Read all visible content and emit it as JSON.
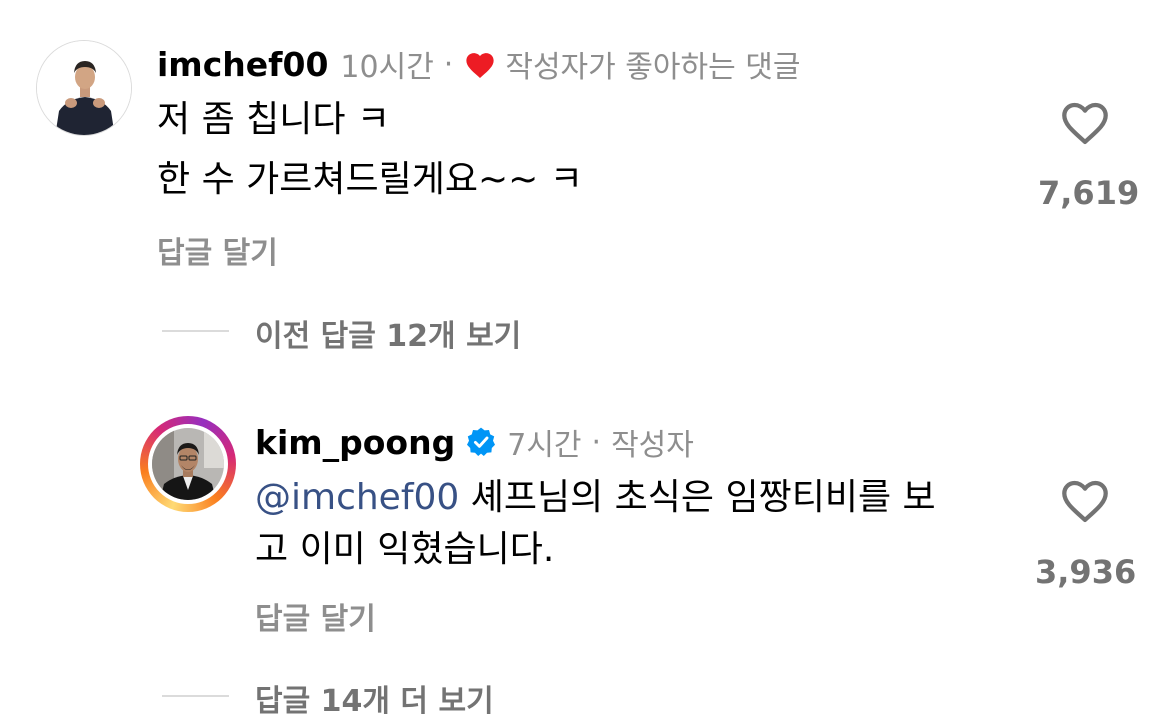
{
  "comments": [
    {
      "username": "imchef00",
      "time": "10시간",
      "separator": "·",
      "creator_liked_label": "작성자가 좋아하는 댓글",
      "lines": [
        "저 좀 칩니다 ㅋ",
        "한 수 가르쳐드릴게요~~ ㅋ"
      ],
      "reply_label": "답글 달기",
      "like_count": "7,619"
    },
    {
      "username": "kim_poong",
      "time": "7시간",
      "separator": "·",
      "author_badge": "작성자",
      "mention": "@imchef00",
      "line1_rest": " 셰프님의 초식은 임짱티비를 보",
      "line2": "고 이미 익혔습니다.",
      "reply_label": "답글 달기",
      "like_count": "3,936"
    }
  ],
  "threads": {
    "view_previous": "이전 답글 12개 보기",
    "view_more": "답글 14개 더 보기"
  },
  "colors": {
    "text": "#000000",
    "secondary": "#8e8e8e",
    "mention": "#385185",
    "heart_red": "#ed1c24",
    "verified_blue": "#0095f6"
  },
  "icons": {
    "creator_heart": "heart-filled-icon",
    "verified": "verified-badge-icon",
    "like": "heart-outline-icon"
  }
}
